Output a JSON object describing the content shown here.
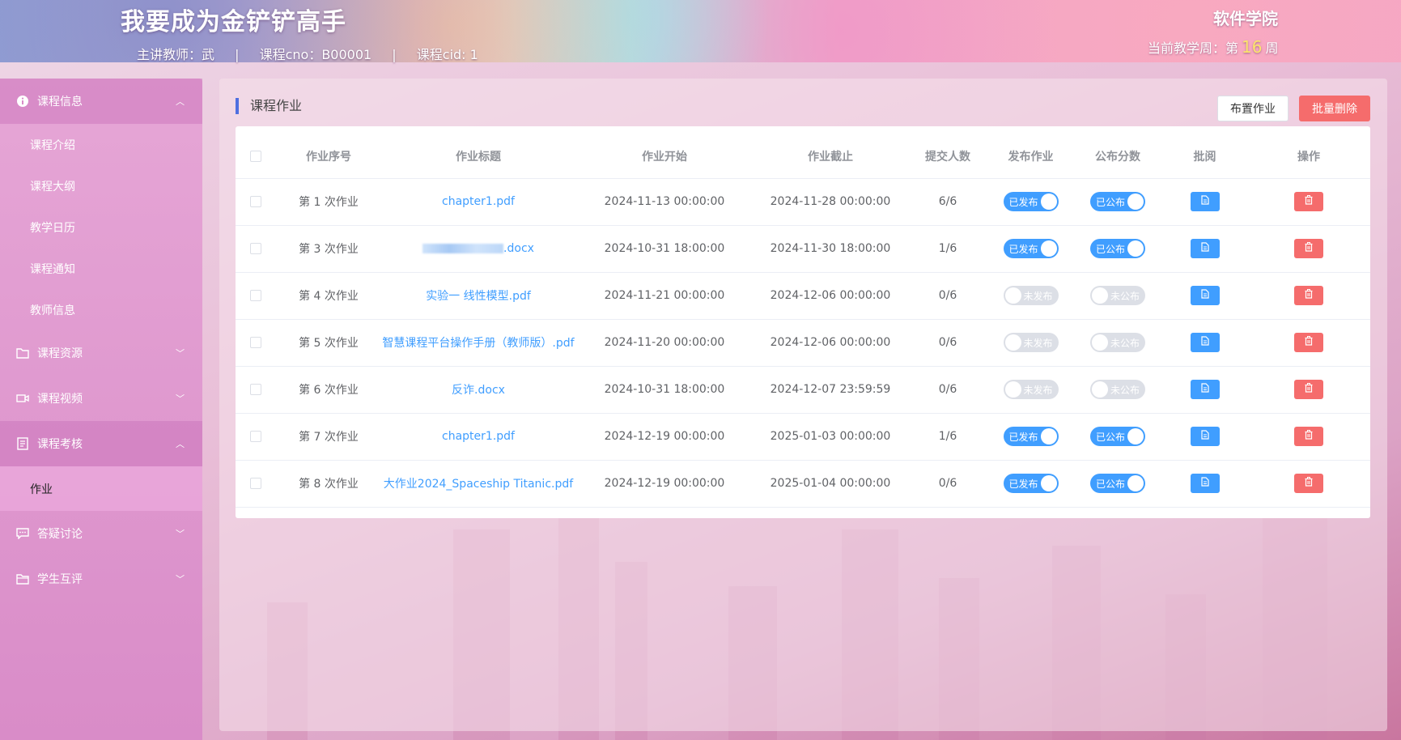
{
  "header": {
    "app_title": "我要成为金铲铲高手",
    "teacher": "主讲教师：武",
    "course_cno": "课程cno：B00001",
    "course_cid": "课程cid: 1",
    "separator": "|",
    "school": "软件学院",
    "week_prefix": "当前教学周：第",
    "week_number": "16",
    "week_suffix": "周"
  },
  "sidebar": {
    "groups": [
      {
        "label": "课程信息",
        "icon": "info-icon",
        "expanded": true,
        "items": [
          "课程介绍",
          "课程大纲",
          "教学日历",
          "课程通知",
          "教师信息"
        ]
      },
      {
        "label": "课程资源",
        "icon": "folder-icon",
        "expanded": false
      },
      {
        "label": "课程视频",
        "icon": "video-icon",
        "expanded": false
      },
      {
        "label": "课程考核",
        "icon": "document-icon",
        "expanded": true,
        "items": [
          "作业"
        ],
        "active_item": "作业"
      },
      {
        "label": "答疑讨论",
        "icon": "chat-icon",
        "expanded": false
      },
      {
        "label": "学生互评",
        "icon": "folder-open-icon",
        "expanded": false
      }
    ]
  },
  "main": {
    "title": "课程作业",
    "assign_button": "布置作业",
    "batch_delete_button": "批量删除",
    "columns": [
      "作业序号",
      "作业标题",
      "作业开始",
      "作业截止",
      "提交人数",
      "发布作业",
      "公布分数",
      "批阅",
      "操作"
    ],
    "rows": [
      {
        "seq": "第 1 次作业",
        "title": "chapter1.pdf",
        "start": "2024-11-13 00:00:00",
        "end": "2024-11-28 00:00:00",
        "submitted": "6/6",
        "publish": "已发布",
        "score": "已公布"
      },
      {
        "seq": "第 3 次作业",
        "title": ".docx",
        "start": "2024-10-31 18:00:00",
        "end": "2024-11-30 18:00:00",
        "submitted": "1/6",
        "publish": "已发布",
        "score": "已公布"
      },
      {
        "seq": "第 4 次作业",
        "title": "实验一 线性模型.pdf",
        "start": "2024-11-21 00:00:00",
        "end": "2024-12-06 00:00:00",
        "submitted": "0/6",
        "publish": "未发布",
        "score": "未公布"
      },
      {
        "seq": "第 5 次作业",
        "title": "智慧课程平台操作手册（教师版）.pdf",
        "start": "2024-11-20 00:00:00",
        "end": "2024-12-06 00:00:00",
        "submitted": "0/6",
        "publish": "未发布",
        "score": "未公布"
      },
      {
        "seq": "第 6 次作业",
        "title": "反诈.docx",
        "start": "2024-10-31 18:00:00",
        "end": "2024-12-07 23:59:59",
        "submitted": "0/6",
        "publish": "未发布",
        "score": "未公布"
      },
      {
        "seq": "第 7 次作业",
        "title": "chapter1.pdf",
        "start": "2024-12-19 00:00:00",
        "end": "2025-01-03 00:00:00",
        "submitted": "1/6",
        "publish": "已发布",
        "score": "已公布"
      },
      {
        "seq": "第 8 次作业",
        "title": "大作业2024_Spaceship Titanic.pdf",
        "start": "2024-12-19 00:00:00",
        "end": "2025-01-04 00:00:00",
        "submitted": "0/6",
        "publish": "已发布",
        "score": "已公布"
      }
    ]
  },
  "colors": {
    "primary": "#409eff",
    "danger": "#f56c6c",
    "sidebar": "#e6a6d6",
    "accent_bar": "#4f6fe0",
    "week_number": "#fce36c"
  }
}
